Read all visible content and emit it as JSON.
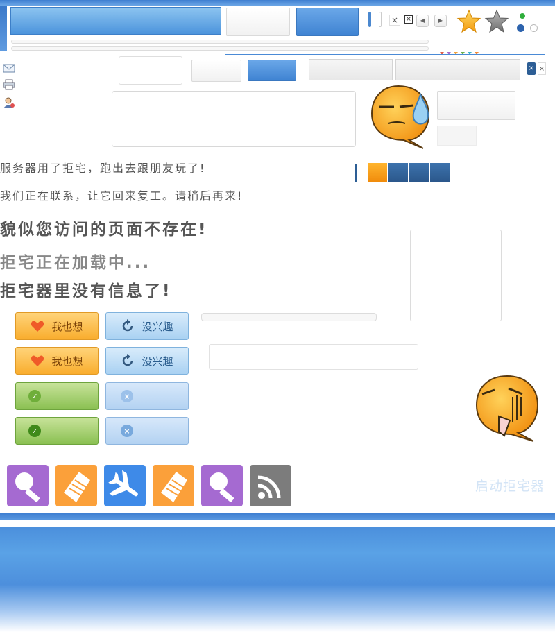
{
  "messages": {
    "line1": "服务器用了拒宅，跑出去跟朋友玩了!",
    "line2": "我们正在联系，让它回来复工。请稍后再来!",
    "line3": "貌似您访问的页面不存在!",
    "line4": "拒宅正在加载中...",
    "line5": "拒宅器里没有信息了!"
  },
  "buttons": {
    "want_label": "我也想",
    "not_interested_label": "没兴趣"
  },
  "launch": {
    "label": "启动拒宅器"
  },
  "colors": {
    "accent_blue": "#4a8ad6",
    "orange": "#f9ad2e",
    "green": "#8ac052",
    "purple": "#a56ad1",
    "tile_orange": "#fba03a",
    "tile_blue": "#3e8ae8",
    "tile_grey": "#7c7c7c",
    "swatches": [
      "#f7a21a",
      "#2d5e95",
      "#2d5e95",
      "#2d5e95"
    ]
  },
  "icons": {
    "star_full": "star-filled-icon",
    "star_empty": "star-grey-icon",
    "mail": "mail-icon",
    "print": "print-icon",
    "user": "user-icon",
    "heart": "heart-icon",
    "refresh": "refresh-icon",
    "check": "check-icon",
    "close": "close-icon",
    "search_tile": "search-icon",
    "broom_tile": "broom-icon",
    "plane_tile": "plane-icon",
    "rss_tile": "rss-icon"
  }
}
